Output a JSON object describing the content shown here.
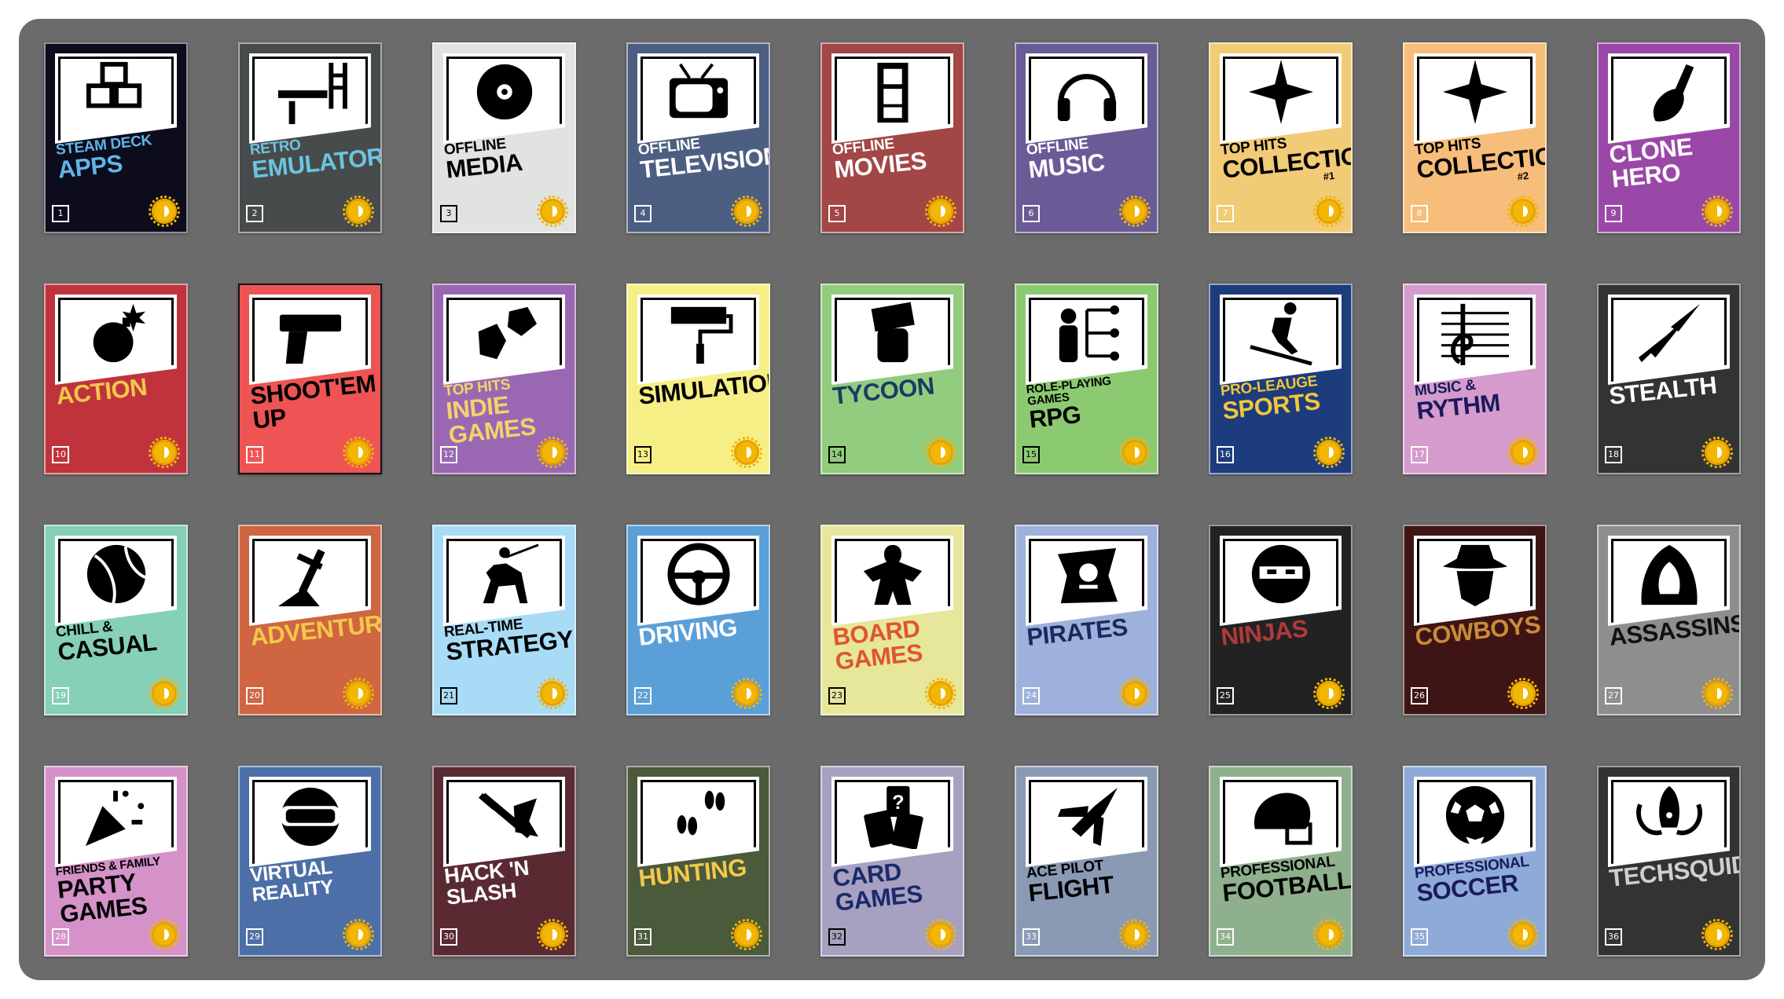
{
  "cards": [
    {
      "sub": "STEAM DECK",
      "main": "APPS",
      "tag": "",
      "num": "1",
      "bg": "#0c0c1c",
      "sub_color": "#5fb4e8",
      "main_color": "#5fb4e8",
      "num_color": "#ffffff",
      "icon": "cubes-icon"
    },
    {
      "sub": "RETRO",
      "main": "EMULATORS",
      "tag": "",
      "num": "2",
      "bg": "#474b4b",
      "sub_color": "#6cc4e0",
      "main_color": "#6cc4e0",
      "num_color": "#ffffff",
      "icon": "ladder-platform-icon"
    },
    {
      "sub": "OFFLINE",
      "main": "MEDIA",
      "tag": "",
      "num": "3",
      "bg": "#e1e3e1",
      "sub_color": "#000000",
      "main_color": "#000000",
      "num_color": "#000000",
      "icon": "disc-icon"
    },
    {
      "sub": "OFFLINE",
      "main": "TELEVISION",
      "tag": "",
      "num": "4",
      "bg": "#4c5f82",
      "sub_color": "#ffffff",
      "main_color": "#ffffff",
      "num_color": "#ffffff",
      "icon": "tv-icon"
    },
    {
      "sub": "OFFLINE",
      "main": "MOVIES",
      "tag": "",
      "num": "5",
      "bg": "#a24646",
      "sub_color": "#ffffff",
      "main_color": "#ffffff",
      "num_color": "#ffffff",
      "icon": "film-strip-icon"
    },
    {
      "sub": "OFFLINE",
      "main": "MUSIC",
      "tag": "",
      "num": "6",
      "bg": "#6a5a96",
      "sub_color": "#ffffff",
      "main_color": "#ffffff",
      "num_color": "#ffffff",
      "icon": "headphones-icon"
    },
    {
      "sub": "TOP HITS",
      "main": "COLLECTION",
      "tag": "#1",
      "num": "7",
      "bg": "#f1cb75",
      "sub_color": "#000000",
      "main_color": "#000000",
      "num_color": "#ffffff",
      "icon": "star-burst-icon"
    },
    {
      "sub": "TOP HITS",
      "main": "COLLECTION",
      "tag": "#2",
      "num": "8",
      "bg": "#f7bd7a",
      "sub_color": "#000000",
      "main_color": "#000000",
      "num_color": "#ffffff",
      "icon": "star-burst-icon"
    },
    {
      "sub": "",
      "main": "CLONE HERO",
      "tag": "",
      "num": "9",
      "bg": "#9a48a8",
      "sub_color": "#ffffff",
      "main_color": "#ffffff",
      "num_color": "#ffffff",
      "icon": "guitar-icon"
    },
    {
      "sub": "",
      "main": "ACTION",
      "tag": "",
      "num": "10",
      "bg": "#c0333c",
      "sub_color": "#f2c84b",
      "main_color": "#f2c84b",
      "num_color": "#ffffff",
      "icon": "bomb-icon"
    },
    {
      "sub": "",
      "main": "SHOOT'EM UP",
      "tag": "",
      "num": "11",
      "bg": "#ef5454",
      "sub_color": "#000000",
      "main_color": "#000000",
      "num_color": "#ffffff",
      "icon": "pistol-icon"
    },
    {
      "sub": "TOP HITS",
      "main": "INDIE GAMES",
      "tag": "",
      "num": "12",
      "bg": "#9a68b2",
      "sub_color": "#f3d36a",
      "main_color": "#f3d36a",
      "num_color": "#ffffff",
      "icon": "polyhedra-icon"
    },
    {
      "sub": "",
      "main": "SIMULATION",
      "tag": "",
      "num": "13",
      "bg": "#f6ef86",
      "sub_color": "#000000",
      "main_color": "#000000",
      "num_color": "#000000",
      "icon": "paint-roller-icon"
    },
    {
      "sub": "",
      "main": "TYCOON",
      "tag": "",
      "num": "14",
      "bg": "#92cc7e",
      "sub_color": "#1c3a66",
      "main_color": "#1c3a66",
      "num_color": "#000000",
      "icon": "cash-fist-icon"
    },
    {
      "sub": "ROLE-PLAYING GAMES",
      "main": "RPG",
      "tag": "",
      "num": "15",
      "bg": "#8cca72",
      "sub_color": "#000000",
      "main_color": "#000000",
      "num_color": "#000000",
      "icon": "skill-tree-icon"
    },
    {
      "sub": "PRO-LEAUGE",
      "main": "SPORTS",
      "tag": "",
      "num": "16",
      "bg": "#1c3c7e",
      "sub_color": "#f2c53a",
      "main_color": "#f2c53a",
      "num_color": "#ffffff",
      "icon": "skier-icon"
    },
    {
      "sub": "MUSIC &",
      "main": "RYTHM",
      "tag": "",
      "num": "17",
      "bg": "#d59bcc",
      "sub_color": "#1a1a5c",
      "main_color": "#1a1a5c",
      "num_color": "#ffffff",
      "icon": "treble-clef-icon"
    },
    {
      "sub": "",
      "main": "STEALTH",
      "tag": "",
      "num": "18",
      "bg": "#333333",
      "sub_color": "#ffffff",
      "main_color": "#ffffff",
      "num_color": "#ffffff",
      "icon": "kunai-icon"
    },
    {
      "sub": "CHILL &",
      "main": "CASUAL",
      "tag": "",
      "num": "19",
      "bg": "#86d0b8",
      "sub_color": "#000000",
      "main_color": "#000000",
      "num_color": "#ffffff",
      "icon": "beach-ball-icon"
    },
    {
      "sub": "",
      "main": "ADVENTURE",
      "tag": "",
      "num": "20",
      "bg": "#cf6641",
      "sub_color": "#f2c84b",
      "main_color": "#f2c84b",
      "num_color": "#ffffff",
      "icon": "sword-in-stone-icon"
    },
    {
      "sub": "REAL-TIME",
      "main": "STRATEGY",
      "tag": "",
      "num": "21",
      "bg": "#a8dcf6",
      "sub_color": "#000000",
      "main_color": "#000000",
      "num_color": "#000000",
      "icon": "knight-horse-icon"
    },
    {
      "sub": "",
      "main": "DRIVING",
      "tag": "",
      "num": "22",
      "bg": "#5b9fd8",
      "sub_color": "#ffffff",
      "main_color": "#ffffff",
      "num_color": "#ffffff",
      "icon": "steering-wheel-icon"
    },
    {
      "sub": "",
      "main": "BOARD GAMES",
      "tag": "",
      "num": "23",
      "bg": "#e6e79a",
      "sub_color": "#e0552f",
      "main_color": "#e0552f",
      "num_color": "#000000",
      "icon": "meeple-icon"
    },
    {
      "sub": "",
      "main": "PIRATES",
      "tag": "",
      "num": "24",
      "bg": "#9eb0dc",
      "sub_color": "#1a2a5c",
      "main_color": "#1a2a5c",
      "num_color": "#ffffff",
      "icon": "pirate-flag-icon"
    },
    {
      "sub": "",
      "main": "NINJAS",
      "tag": "",
      "num": "25",
      "bg": "#222222",
      "sub_color": "#b03a3a",
      "main_color": "#b03a3a",
      "num_color": "#ffffff",
      "icon": "ninja-icon"
    },
    {
      "sub": "",
      "main": "COWBOYS",
      "tag": "",
      "num": "26",
      "bg": "#3e1414",
      "sub_color": "#c98a3a",
      "main_color": "#c98a3a",
      "num_color": "#ffffff",
      "icon": "cowboy-icon"
    },
    {
      "sub": "",
      "main": "ASSASSINS",
      "tag": "",
      "num": "27",
      "bg": "#8e8e8e",
      "sub_color": "#111111",
      "main_color": "#111111",
      "num_color": "#ffffff",
      "icon": "hood-icon"
    },
    {
      "sub": "FRIENDS & FAMILY",
      "main": "PARTY GAMES",
      "tag": "",
      "num": "28",
      "bg": "#d492c8",
      "sub_color": "#000000",
      "main_color": "#000000",
      "num_color": "#ffffff",
      "icon": "party-popper-icon"
    },
    {
      "sub": "",
      "main": "VIRTUAL REALITY",
      "tag": "",
      "num": "29",
      "bg": "#4d6fa8",
      "sub_color": "#ffffff",
      "main_color": "#ffffff",
      "num_color": "#ffffff",
      "icon": "vr-headset-icon"
    },
    {
      "sub": "",
      "main": "HACK 'N SLASH",
      "tag": "",
      "num": "30",
      "bg": "#5a2a32",
      "sub_color": "#ffffff",
      "main_color": "#ffffff",
      "num_color": "#ffffff",
      "icon": "slash-sword-icon"
    },
    {
      "sub": "",
      "main": "HUNTING",
      "tag": "",
      "num": "31",
      "bg": "#4a5a3a",
      "sub_color": "#f2c84b",
      "main_color": "#f2c84b",
      "num_color": "#ffffff",
      "icon": "hoof-prints-icon"
    },
    {
      "sub": "",
      "main": "CARD GAMES",
      "tag": "",
      "num": "32",
      "bg": "#a8a0c0",
      "sub_color": "#1a2a6a",
      "main_color": "#1a2a6a",
      "num_color": "#000000",
      "icon": "playing-cards-icon"
    },
    {
      "sub": "ACE PILOT",
      "main": "FLIGHT",
      "tag": "",
      "num": "33",
      "bg": "#8a9ab4",
      "sub_color": "#000000",
      "main_color": "#000000",
      "num_color": "#ffffff",
      "icon": "jet-icon"
    },
    {
      "sub": "PROFESSIONAL",
      "main": "FOOTBALL",
      "tag": "",
      "num": "34",
      "bg": "#8fb08c",
      "sub_color": "#000000",
      "main_color": "#000000",
      "num_color": "#ffffff",
      "icon": "helmet-icon"
    },
    {
      "sub": "PROFESSIONAL",
      "main": "SOCCER",
      "tag": "",
      "num": "35",
      "bg": "#8eaad8",
      "sub_color": "#1a1a5c",
      "main_color": "#1a1a5c",
      "num_color": "#ffffff",
      "icon": "soccer-ball-icon"
    },
    {
      "sub": "",
      "main": "TECHSQUIDTV",
      "tag": "",
      "num": "36",
      "bg": "#333333",
      "sub_color": "#cfcfcf",
      "main_color": "#cfcfcf",
      "num_color": "#ffffff",
      "icon": "squid-icon"
    }
  ]
}
